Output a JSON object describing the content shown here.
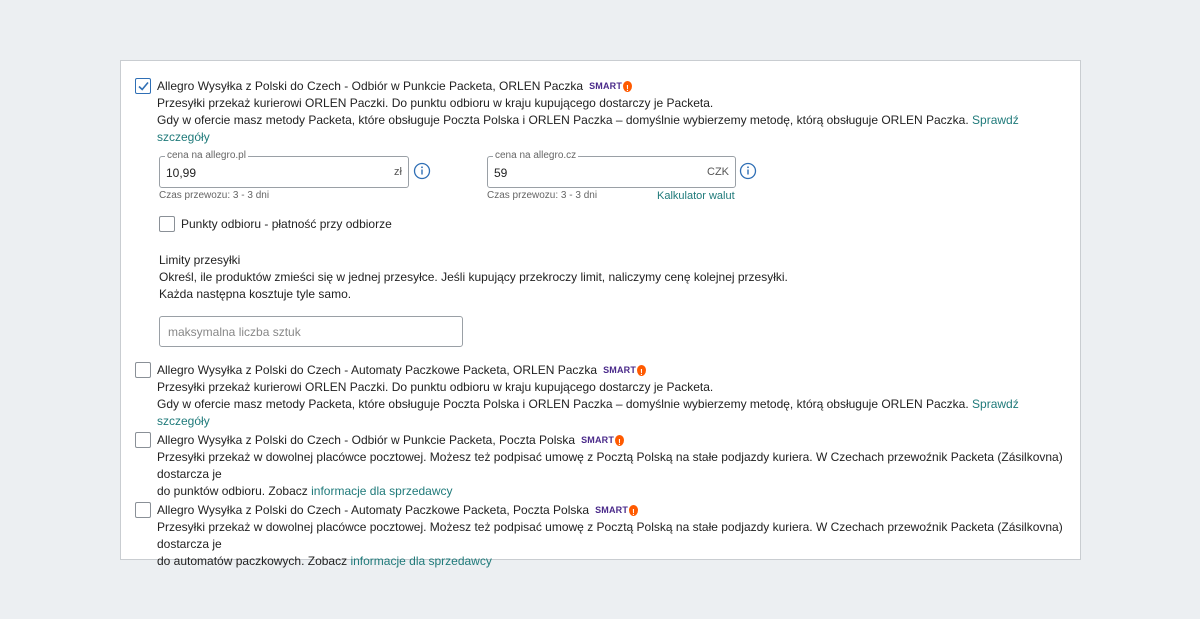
{
  "options": [
    {
      "checked": true,
      "title": "Allegro Wysyłka z Polski do Czech - Odbiór w Punkcie Packeta, ORLEN Paczka",
      "badge": "SMART",
      "line1": "Przesyłki przekaż kurierowi ORLEN Paczki. Do punktu odbioru w kraju kupującego dostarczy je Packeta.",
      "line2": "Gdy w ofercie masz metody Packeta, które obsługuje Poczta Polska i ORLEN Paczka – domyślnie wybierzemy metodę, którą obsługuje ORLEN Paczka.",
      "link": "Sprawdź szczegóły"
    },
    {
      "checked": false,
      "title": "Allegro Wysyłka z Polski do Czech - Automaty Paczkowe Packeta, ORLEN Paczka",
      "badge": "SMART",
      "line1": "Przesyłki przekaż kurierowi ORLEN Paczki. Do punktu odbioru w kraju kupującego dostarczy je Packeta.",
      "line2": "Gdy w ofercie masz metody Packeta, które obsługuje Poczta Polska i ORLEN Paczka – domyślnie wybierzemy metodę, którą obsługuje ORLEN Paczka.",
      "link": "Sprawdź szczegóły"
    },
    {
      "checked": false,
      "title": "Allegro Wysyłka z Polski do Czech - Odbiór w Punkcie Packeta, Poczta Polska",
      "badge": "SMART",
      "line1": "Przesyłki przekaż w dowolnej placówce pocztowej. Możesz też podpisać umowę z Pocztą Polską na stałe podjazdy kuriera. W Czechach przewoźnik Packeta (Zásilkovna) dostarcza je",
      "line2": "do punktów odbioru. Zobacz",
      "link": "informacje dla sprzedawcy"
    },
    {
      "checked": false,
      "title": "Allegro Wysyłka z Polski do Czech - Automaty Paczkowe Packeta, Poczta Polska",
      "badge": "SMART",
      "line1": "Przesyłki przekaż w dowolnej placówce pocztowej. Możesz też podpisać umowę z Pocztą Polską na stałe podjazdy kuriera. W Czechach przewoźnik Packeta (Zásilkovna) dostarcza je",
      "line2": "do automatów paczkowych. Zobacz",
      "link": "informacje dla sprzedawcy"
    }
  ],
  "price_pl": {
    "label": "cena na allegro.pl",
    "value": "10,99",
    "unit": "zł",
    "note": "Czas przewozu: 3 - 3 dni"
  },
  "price_cz": {
    "label": "cena na allegro.cz",
    "value": "59",
    "unit": "CZK",
    "note": "Czas przewozu: 3 - 3 dni"
  },
  "calculator_link": "Kalkulator walut",
  "pickup_payment": {
    "checked": false,
    "label": "Punkty odbioru - płatność przy odbiorze"
  },
  "limits": {
    "heading": "Limity przesyłki",
    "line1": "Określ, ile produktów zmieści się w jednej przesyłce. Jeśli kupujący przekroczy limit, naliczymy cenę kolejnej przesyłki.",
    "line2": "Każda następna kosztuje tyle samo.",
    "placeholder": "maksymalna liczba sztuk"
  },
  "colors": {
    "link": "#1f7a7a",
    "checkbox_checked": "#2f6fb5",
    "badge": "#ff5a00",
    "smart_text": "#4a2a8a"
  }
}
